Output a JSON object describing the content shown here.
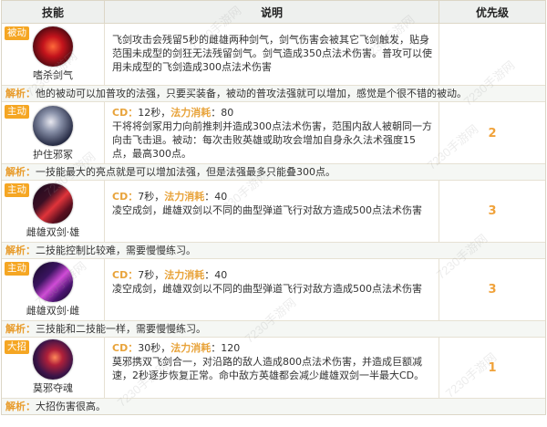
{
  "header": {
    "skill": "技能",
    "desc": "说明",
    "priority": "优先级"
  },
  "watermark": "7230手游网",
  "skills": [
    {
      "tag": "被动",
      "name": "嗜杀剑气",
      "icon": "crimson-swords-icon",
      "cd_label": "",
      "cd_value": "",
      "mana_label": "",
      "mana_value": "",
      "desc": "飞剑攻击会残留5秒的雌雄两种剑气，剑气伤害会被其它飞剑触发，贴身范围未成型的剑狂无法残留剑气。剑气造成350点法术伤害。普攻可以使用未成型的飞剑造成300点法术伤害",
      "priority": "",
      "note_label": "解析：",
      "note": "他的被动可以加普攻的法强，只要买装备，被动的普攻法强就可以增加，感觉是个很不错的被动。"
    },
    {
      "tag": "主动",
      "name": "护住邪冢",
      "icon": "sword-shield-icon",
      "cd_label": "CD：",
      "cd_value": "12秒，",
      "mana_label": "法力消耗",
      "mana_value": "：80",
      "desc": "干将将剑冢用力向前推刺并造成300点法术伤害，范围内敌人被朝同一方向击飞击退。被动：每次击败英雄或助攻会增加自身永久法术强度15点，最高300点。",
      "priority": "2",
      "note_label": "解析：",
      "note": "一技能最大的亮点就是可以增加法强，但是法强最多只能叠300点。"
    },
    {
      "tag": "主动",
      "name": "雌雄双剑·雄",
      "icon": "red-blade-icon",
      "cd_label": "CD：",
      "cd_value": "7秒，",
      "mana_label": "法力消耗",
      "mana_value": "：40",
      "desc": "凌空成剑，雌雄双剑以不同的曲型弹道飞行对敌方造成500点法术伤害",
      "priority": "3",
      "note_label": "解析：",
      "note": "二技能控制比较难，需要慢慢练习。"
    },
    {
      "tag": "主动",
      "name": "雌雄双剑·雌",
      "icon": "purple-blade-icon",
      "cd_label": "CD：",
      "cd_value": "7秒，",
      "mana_label": "法力消耗",
      "mana_value": "：40",
      "desc": "凌空成剑，雌雄双剑以不同的曲型弹道飞行对敌方造成500点法术伤害",
      "priority": "3",
      "note_label": "解析：",
      "note": "三技能和二技能一样，需要慢慢练习。"
    },
    {
      "tag": "大招",
      "name": "莫邪夺魂",
      "icon": "dark-vortex-icon",
      "cd_label": "CD：",
      "cd_value": "30秒，",
      "mana_label": "法力消耗",
      "mana_value": "：120",
      "desc": "莫邪携双飞剑合一，对沿路的敌人造成800点法术伤害，并造成巨额减速，2秒逐步恢复正常。命中敌方英雄都会减少雌雄双剑一半最大CD。",
      "priority": "1",
      "note_label": "解析：",
      "note": "大招伤害很高。"
    }
  ]
}
